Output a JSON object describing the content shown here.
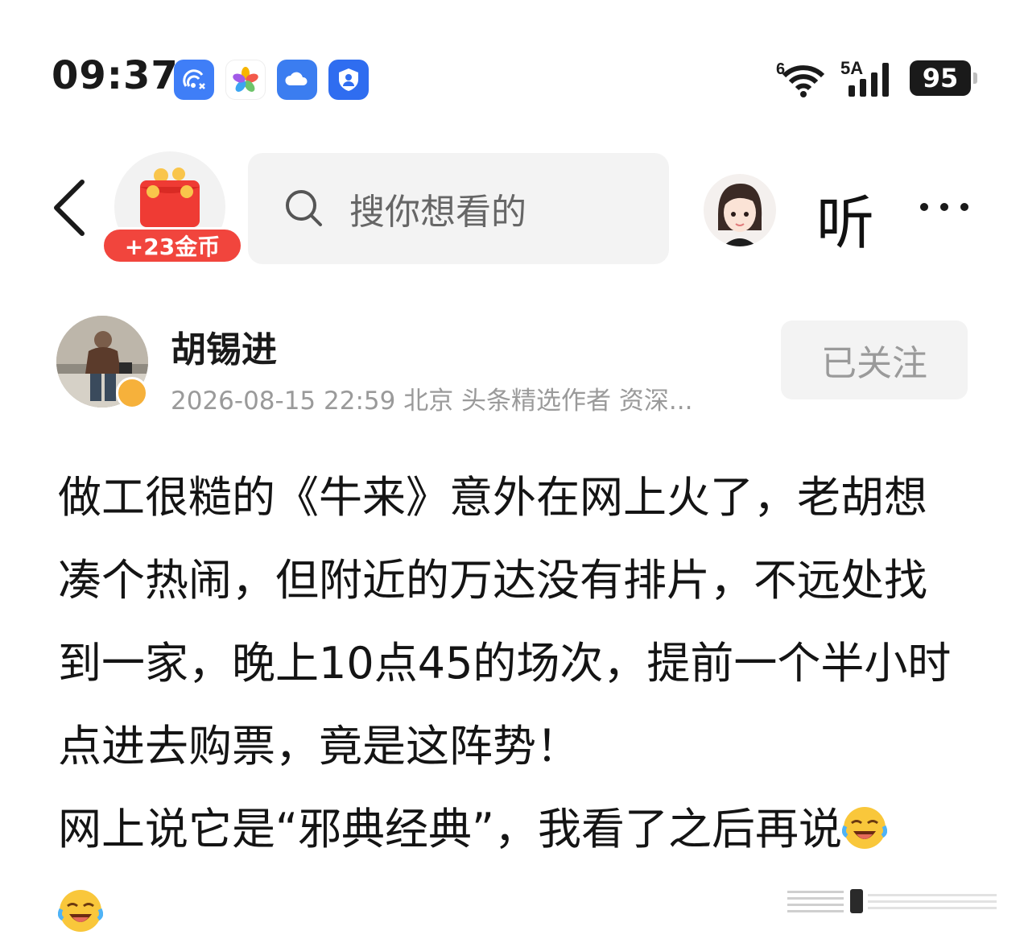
{
  "status_bar": {
    "time": "09:37",
    "app_icons": [
      "accessibility-icon",
      "photos-icon",
      "cloud-icon",
      "security-icon"
    ],
    "wifi_label": "6",
    "signal_label": "5A",
    "battery": "95"
  },
  "nav": {
    "back_icon": "chevron-left-icon",
    "reward_badge": "+23金币",
    "search_placeholder": "搜你想看的",
    "listen_label": "听",
    "more_icon": "more-dots-icon"
  },
  "author": {
    "name": "胡锡进",
    "meta": "2026-08-15 22:59 北京 头条精选作者 资深...",
    "follow_label": "已关注"
  },
  "article": {
    "paragraph_1": "做工很糙的《牛来》意外在网上火了，老胡想凑个热闹，但附近的万达没有排片，不远处找到一家，晚上10点45的场次，提前一个半小时点进去购票，竟是这阵势！",
    "paragraph_2": "网上说它是“邪典经典”，我看了之后再说"
  },
  "colors": {
    "accent_red": "#f1453d",
    "search_bg": "#f3f3f3",
    "meta_gray": "#9a9a9a"
  }
}
